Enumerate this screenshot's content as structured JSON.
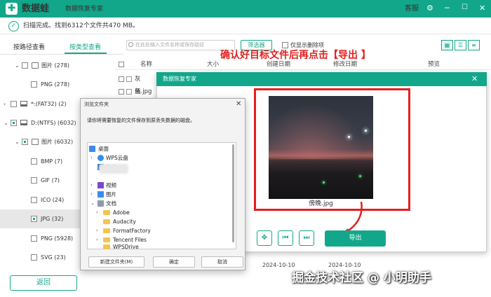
{
  "app": {
    "name": "数据蛙",
    "subtitle": "数据恢复专家",
    "logo_glyph": "✚",
    "accent": "#12a78a"
  },
  "titlebar": {
    "service": "客服",
    "icons": [
      "settings-icon",
      "minimize-icon",
      "maximize-icon",
      "close-icon"
    ]
  },
  "status": {
    "text": "扫描完成。找到6312个文件共470 MB。"
  },
  "tabs": {
    "by_path": "按路径查看",
    "by_type": "按类型查看"
  },
  "tree": [
    {
      "label": "图片 (278)"
    },
    {
      "label": "PNG (278)"
    },
    {
      "label": "*:(FAT32) (2)"
    },
    {
      "label": "D:(NTFS) (6032)"
    },
    {
      "label": "图片 (6032)"
    },
    {
      "label": "BMP (7)"
    },
    {
      "label": "GIF (7)"
    },
    {
      "label": "ICO (24)"
    },
    {
      "label": "JPG (32)"
    },
    {
      "label": "PNG (5928)"
    },
    {
      "label": "SVG (23)"
    }
  ],
  "back_button": "返回",
  "toolbar": {
    "search_placeholder": "在此处输入文件名称或保存路径",
    "filter": "筛选器",
    "only_deleted": "仅显示删除项"
  },
  "columns": {
    "name": "名称",
    "size": "大小",
    "created": "创建日期",
    "modified": "修改日期",
    "preview": "预览"
  },
  "files": [
    {
      "name": "灰色.jpg"
    },
    {
      "name": "蓝天.jpg"
    }
  ],
  "annotation": "确认好目标文件后再点击【导出 】",
  "preview_dialog": {
    "title": "数据恢复专家",
    "filename": "傍晚.jpg",
    "export": "导出"
  },
  "browse_dialog": {
    "title": "浏览文件夹",
    "prompt": "请你将需要恢复的文件保存到原丢失数据的磁盘。",
    "items": [
      {
        "label": "桌面"
      },
      {
        "label": "WPS云盘"
      },
      {
        "label": "图库"
      },
      {
        "label": "视频"
      },
      {
        "label": "图片"
      },
      {
        "label": "文档"
      },
      {
        "label": "Adobe"
      },
      {
        "label": "Audacity"
      },
      {
        "label": "FormatFactory"
      },
      {
        "label": "Tencent Files"
      },
      {
        "label": "WPSDrive"
      }
    ],
    "new_folder": "新建文件夹(M)",
    "ok": "确定",
    "cancel": "取消"
  },
  "bottom_dates": [
    "2024-10-10",
    "2024-10-10"
  ],
  "watermark": "掘金技术社区 @ 小明助手"
}
